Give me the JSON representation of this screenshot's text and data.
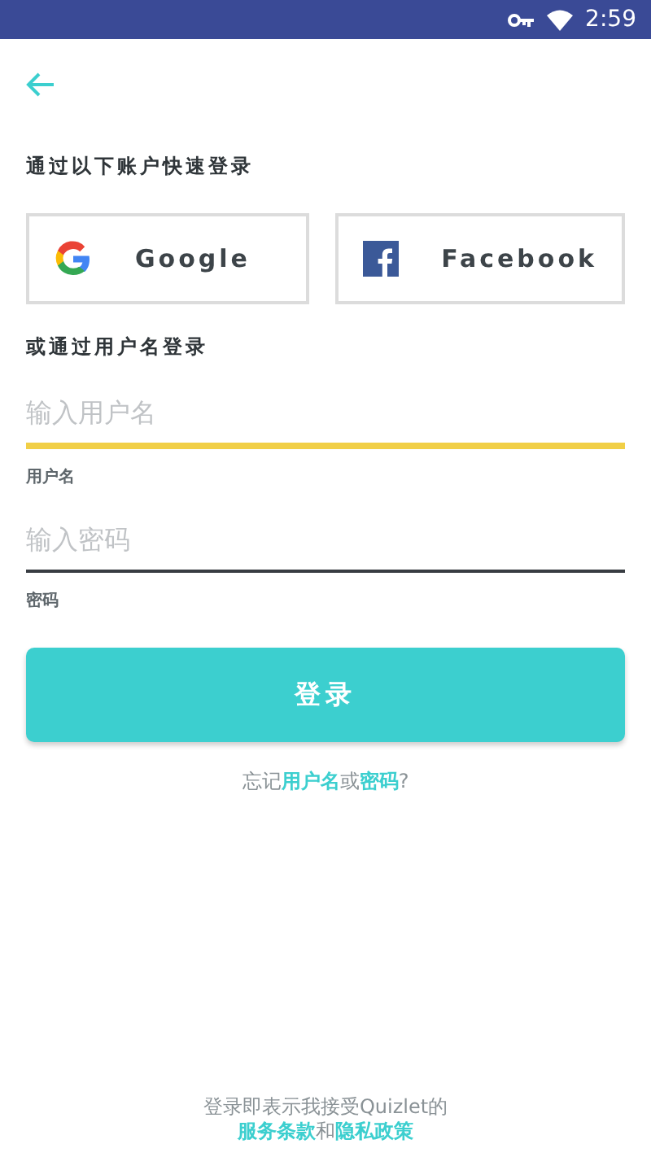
{
  "status_bar": {
    "time": "2:59"
  },
  "social_heading": "通过以下账户快速登录",
  "social_buttons": [
    {
      "kind": "google",
      "label": "Google"
    },
    {
      "kind": "facebook",
      "label": "Facebook"
    }
  ],
  "username_heading": "或通过用户名登录",
  "fields": [
    {
      "placeholder": "输入用户名",
      "label": "用户名",
      "focused": true
    },
    {
      "placeholder": "输入密码",
      "label": "密码",
      "focused": false
    }
  ],
  "login_button": "登录",
  "forgot": [
    {
      "kind": "plain",
      "text": "忘记"
    },
    {
      "kind": "link",
      "text": "用户名"
    },
    {
      "kind": "plain",
      "text": "或"
    },
    {
      "kind": "link",
      "text": "密码"
    },
    {
      "kind": "plain",
      "text": "?"
    }
  ],
  "terms_line": "登录即表示我接受Quizlet的",
  "terms_links": [
    {
      "kind": "link",
      "text": "服务条款"
    },
    {
      "kind": "plain",
      "text": "和"
    },
    {
      "kind": "link",
      "text": "隐私政策"
    }
  ]
}
